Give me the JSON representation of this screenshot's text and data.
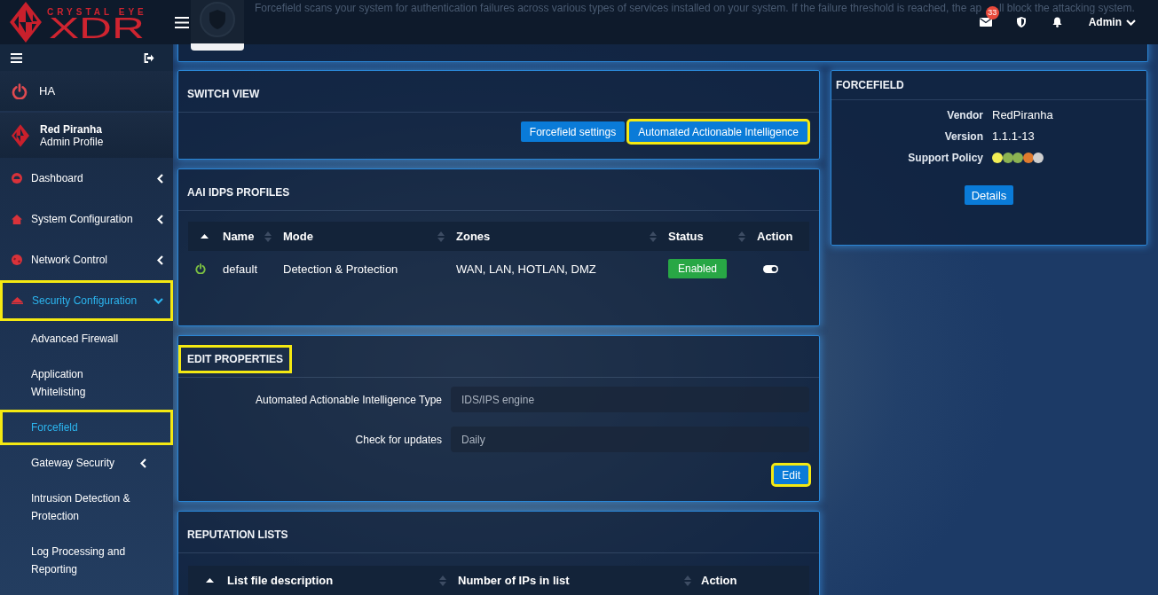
{
  "sidebar": {
    "brand": {
      "tagline": "CRYSTAL EYE",
      "name": "XDR"
    },
    "ha": {
      "label": "HA"
    },
    "profile": {
      "name": "Red Piranha",
      "role": "Admin Profile"
    },
    "menu": [
      {
        "label": "Dashboard",
        "selected": false,
        "expanded": false,
        "highlighted": false
      },
      {
        "label": "System Configuration",
        "selected": false,
        "expanded": false,
        "highlighted": false
      },
      {
        "label": "Network Control",
        "selected": false,
        "expanded": false,
        "highlighted": false
      },
      {
        "label": "Security Configuration",
        "selected": true,
        "expanded": true,
        "highlighted": true,
        "children": [
          {
            "label": "Advanced Firewall",
            "kind": "link",
            "selected": false,
            "highlighted": false
          },
          {
            "label": "Application Whitelisting",
            "kind": "link",
            "selected": false,
            "highlighted": false
          },
          {
            "label": "Forcefield",
            "kind": "link",
            "selected": true,
            "highlighted": true
          },
          {
            "label": "Gateway Security",
            "kind": "group",
            "expanded": false,
            "selected": false,
            "highlighted": false
          },
          {
            "label": "Intrusion Detection & Protection",
            "kind": "link",
            "selected": false,
            "highlighted": false
          },
          {
            "label": "Log Processing and Reporting",
            "kind": "link",
            "selected": false,
            "highlighted": false
          }
        ]
      }
    ]
  },
  "header": {
    "notifications": "33",
    "user": "Admin"
  },
  "intro": {
    "description_parts": [
      "Forcefield scans your system for authentication failures across various types of services installed on your system. If the failure threshold is reached, the ap",
      "ll block the attacking system."
    ]
  },
  "switch_view": {
    "title": "SWITCH VIEW",
    "highlighted": false,
    "buttons": [
      {
        "label": "Forcefield settings",
        "highlighted": false
      },
      {
        "label": "Automated Actionable Intelligence",
        "highlighted": true
      }
    ]
  },
  "profiles": {
    "title": "AAI IDPS PROFILES",
    "highlighted": false,
    "columns": [
      {
        "sorted": true,
        "sortable": false
      },
      {
        "label": "Name",
        "sorted": false,
        "sortable": true
      },
      {
        "label": "Mode",
        "sorted": false,
        "sortable": true
      },
      {
        "label": "Zones",
        "sorted": false,
        "sortable": true
      },
      {
        "label": "Status",
        "sorted": false,
        "sortable": true
      },
      {
        "label": "Action",
        "sorted": false,
        "sortable": false
      }
    ],
    "rows": [
      {
        "active": true,
        "name": "default",
        "mode": "Detection & Protection",
        "zones": "WAN, LAN, HOTLAN, DMZ",
        "status": "Enabled",
        "on": true
      }
    ]
  },
  "edit_properties": {
    "title": "EDIT PROPERTIES",
    "highlighted": true,
    "fields": [
      {
        "label": "Automated Actionable Intelligence Type",
        "value": "IDS/IPS engine",
        "disabled": true
      },
      {
        "label": "Check for updates",
        "value": "Daily",
        "disabled": true
      }
    ],
    "button": {
      "label": "Edit",
      "highlighted": true
    }
  },
  "reputation_lists": {
    "title": "REPUTATION LISTS",
    "highlighted": false,
    "columns": [
      {
        "sorted": true,
        "sortable": false
      },
      {
        "label": "List file description",
        "sorted": false,
        "sortable": true
      },
      {
        "label": "Number of IPs in list",
        "sorted": false,
        "sortable": true
      },
      {
        "label": "Action",
        "sorted": false,
        "sortable": false
      }
    ]
  },
  "forcefield": {
    "title": "FORCEFIELD",
    "highlighted": false,
    "properties": [
      {
        "label": "Vendor",
        "value": "RedPiranha"
      },
      {
        "label": "Version",
        "value": "1.1.1-13"
      }
    ],
    "support_policy": {
      "label": "Support Policy",
      "dots": [
        {
          "color": "#f2ee55"
        },
        {
          "color": "#8db352"
        },
        {
          "color": "#8db352"
        },
        {
          "color": "#e07b2e"
        },
        {
          "color": "#cfcfcf"
        }
      ]
    },
    "button": "Details"
  }
}
